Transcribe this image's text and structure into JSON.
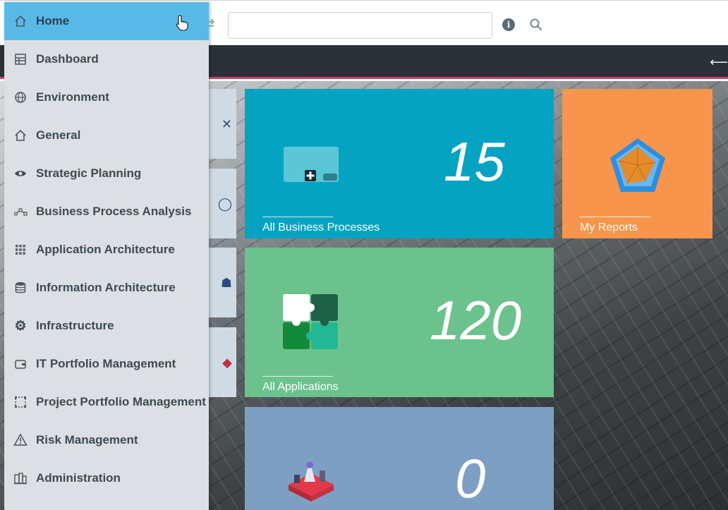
{
  "search": {
    "value": "",
    "placeholder": ""
  },
  "menu": {
    "items": [
      {
        "label": "Home",
        "icon": "home-icon",
        "active": true
      },
      {
        "label": "Dashboard",
        "icon": "dashboard-icon"
      },
      {
        "label": "Environment",
        "icon": "globe-icon"
      },
      {
        "label": "General",
        "icon": "home-outline-icon"
      },
      {
        "label": "Strategic Planning",
        "icon": "eye-icon"
      },
      {
        "label": "Business Process Analysis",
        "icon": "process-flow-icon"
      },
      {
        "label": "Application Architecture",
        "icon": "grid-icon"
      },
      {
        "label": "Information Architecture",
        "icon": "database-icon"
      },
      {
        "label": "Infrastructure",
        "icon": "gear-icon"
      },
      {
        "label": "IT Portfolio Management",
        "icon": "wallet-icon"
      },
      {
        "label": "Project Portfolio Management",
        "icon": "dotted-square-icon"
      },
      {
        "label": "Risk Management",
        "icon": "warning-icon"
      },
      {
        "label": "Administration",
        "icon": "building-icon"
      }
    ]
  },
  "tiles": {
    "business_processes": {
      "count": "15",
      "caption": "All Business Processes",
      "color": "#05a3c2",
      "icon": "process-card-icon"
    },
    "applications": {
      "count": "120",
      "caption": "All Applications",
      "color": "#6cc28d",
      "icon": "puzzle-icon"
    },
    "third": {
      "count": "0",
      "caption": "",
      "color": "#7e9fc4",
      "icon": "isometric-infrastructure-icon"
    },
    "reports": {
      "caption": "My Reports",
      "color": "#f6954b",
      "icon": "radar-chart-icon"
    }
  },
  "colors": {
    "menu_active": "#59b9e6",
    "header_dark": "#2b3236",
    "header_accent": "#d23c6e"
  }
}
